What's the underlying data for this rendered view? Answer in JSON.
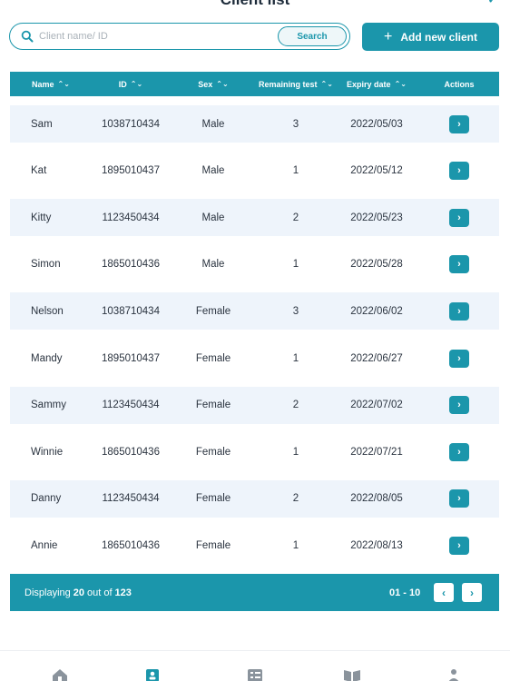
{
  "header": {
    "title": "Client list",
    "corner_glyph": "✓"
  },
  "search": {
    "placeholder": "Client name/ ID",
    "button_label": "Search",
    "icon": "search-icon"
  },
  "add_button": {
    "label": "Add new client",
    "icon": "plus-icon"
  },
  "table": {
    "columns": [
      "Name",
      "ID",
      "Sex",
      "Remaining test",
      "Expiry date",
      "Actions"
    ],
    "sort_glyph": "⌃⌄",
    "action_glyph": "›",
    "rows": [
      {
        "name": "Sam",
        "id": "1038710434",
        "sex": "Male",
        "remaining": "3",
        "expiry": "2022/05/03"
      },
      {
        "name": "Kat",
        "id": "1895010437",
        "sex": "Male",
        "remaining": "1",
        "expiry": "2022/05/12"
      },
      {
        "name": "Kitty",
        "id": "1123450434",
        "sex": "Male",
        "remaining": "2",
        "expiry": "2022/05/23"
      },
      {
        "name": "Simon",
        "id": "1865010436",
        "sex": "Male",
        "remaining": "1",
        "expiry": "2022/05/28"
      },
      {
        "name": "Nelson",
        "id": "1038710434",
        "sex": "Female",
        "remaining": "3",
        "expiry": "2022/06/02"
      },
      {
        "name": "Mandy",
        "id": "1895010437",
        "sex": "Female",
        "remaining": "1",
        "expiry": "2022/06/27"
      },
      {
        "name": "Sammy",
        "id": "1123450434",
        "sex": "Female",
        "remaining": "2",
        "expiry": "2022/07/02"
      },
      {
        "name": "Winnie",
        "id": "1865010436",
        "sex": "Female",
        "remaining": "1",
        "expiry": "2022/07/21"
      },
      {
        "name": "Danny",
        "id": "1123450434",
        "sex": "Female",
        "remaining": "2",
        "expiry": "2022/08/05"
      },
      {
        "name": "Annie",
        "id": "1865010436",
        "sex": "Female",
        "remaining": "1",
        "expiry": "2022/08/13"
      }
    ]
  },
  "pagination": {
    "prefix": "Displaying",
    "shown": "20",
    "middle": "out of",
    "total": "123",
    "range": "01 - 10",
    "prev_glyph": "‹",
    "next_glyph": "›"
  },
  "bottom_nav": {
    "items": [
      "home-icon",
      "clients-icon",
      "checklist-icon",
      "book-icon",
      "profile-icon"
    ]
  },
  "colors": {
    "primary": "#1b96ab",
    "row_alt": "#eef4fb",
    "text": "#2b3440"
  }
}
